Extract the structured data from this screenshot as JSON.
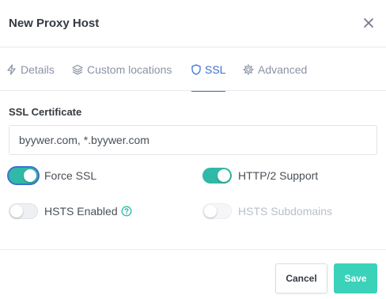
{
  "modal": {
    "title": "New Proxy Host"
  },
  "tabs": [
    {
      "label": "Details",
      "icon": "lightning-icon",
      "active": false
    },
    {
      "label": "Custom locations",
      "icon": "layers-icon",
      "active": false
    },
    {
      "label": "SSL",
      "icon": "shield-icon",
      "active": true
    },
    {
      "label": "Advanced",
      "icon": "gear-icon",
      "active": false
    }
  ],
  "ssl": {
    "section_label": "SSL Certificate",
    "certificate_value": "byywer.com, *.byywer.com",
    "toggles": {
      "force_ssl": {
        "label": "Force SSL",
        "checked": true,
        "disabled": false
      },
      "http2": {
        "label": "HTTP/2 Support",
        "checked": true,
        "disabled": false
      },
      "hsts": {
        "label": "HSTS Enabled",
        "checked": false,
        "disabled": false
      },
      "hsts_subdomains": {
        "label": "HSTS Subdomains",
        "checked": false,
        "disabled": true
      }
    }
  },
  "footer": {
    "cancel_label": "Cancel",
    "save_label": "Save"
  },
  "colors": {
    "accent": "#2fb9a6",
    "save_button": "#3ad2b9",
    "active_tab": "#3e6fd1"
  }
}
